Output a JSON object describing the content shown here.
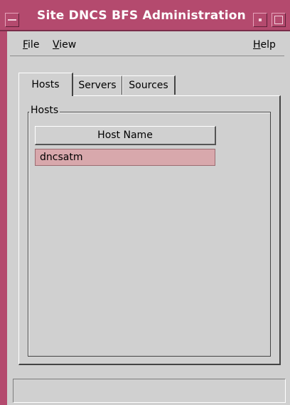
{
  "window": {
    "title": "Site DNCS BFS Administration"
  },
  "menubar": {
    "file": {
      "prefix": "",
      "mnemonic": "F",
      "suffix": "ile"
    },
    "view": {
      "prefix": "",
      "mnemonic": "V",
      "suffix": "iew"
    },
    "help": {
      "prefix": "",
      "mnemonic": "H",
      "suffix": "elp"
    }
  },
  "tabs": [
    {
      "label": "Hosts",
      "active": true
    },
    {
      "label": "Servers",
      "active": false
    },
    {
      "label": "Sources",
      "active": false
    }
  ],
  "hosts_panel": {
    "group_title": "Hosts",
    "column_header": "Host Name",
    "rows": [
      "dncsatm"
    ]
  },
  "status_bar": {
    "text": ""
  },
  "colors": {
    "title_bar": "#b44a6e",
    "selected_row": "#d8a8ac",
    "window_bg": "#d0d0d0"
  }
}
